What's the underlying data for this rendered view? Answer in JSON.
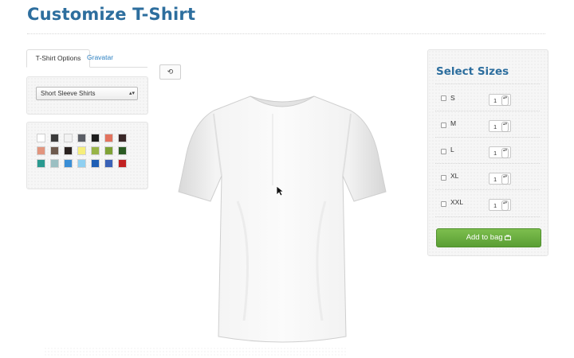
{
  "page": {
    "title": "Customize T-Shirt"
  },
  "tabs": [
    {
      "label": "T-Shirt Options",
      "active": true
    },
    {
      "label": "Gravatar",
      "active": false
    }
  ],
  "style_select": {
    "value": "Short Sleeve Shirts"
  },
  "colors": [
    "#ffffff",
    "#3b3b3b",
    "#f2f2f2",
    "#5b5e66",
    "#1e1e1e",
    "#e3735e",
    "#3a2727",
    "#e2957e",
    "#6e5a4d",
    "#2a2220",
    "#f6ee7a",
    "#98b447",
    "#7fa236",
    "#2a5a22",
    "#2a9a90",
    "#9bbfc2",
    "#3a8ed6",
    "#8fd0f1",
    "#1f5fb5",
    "#3a62b7",
    "#c22222"
  ],
  "rotate_button": {
    "icon": "rotate-icon",
    "glyph": "⟲"
  },
  "sizes": {
    "title": "Select Sizes",
    "rows": [
      {
        "label": "S",
        "qty": "1"
      },
      {
        "label": "M",
        "qty": "1"
      },
      {
        "label": "L",
        "qty": "1"
      },
      {
        "label": "XL",
        "qty": "1"
      },
      {
        "label": "XXL",
        "qty": "1"
      }
    ],
    "spinner_glyph": "▴▾",
    "add_button": "Add to bag"
  },
  "select_arrow": "▴▾"
}
